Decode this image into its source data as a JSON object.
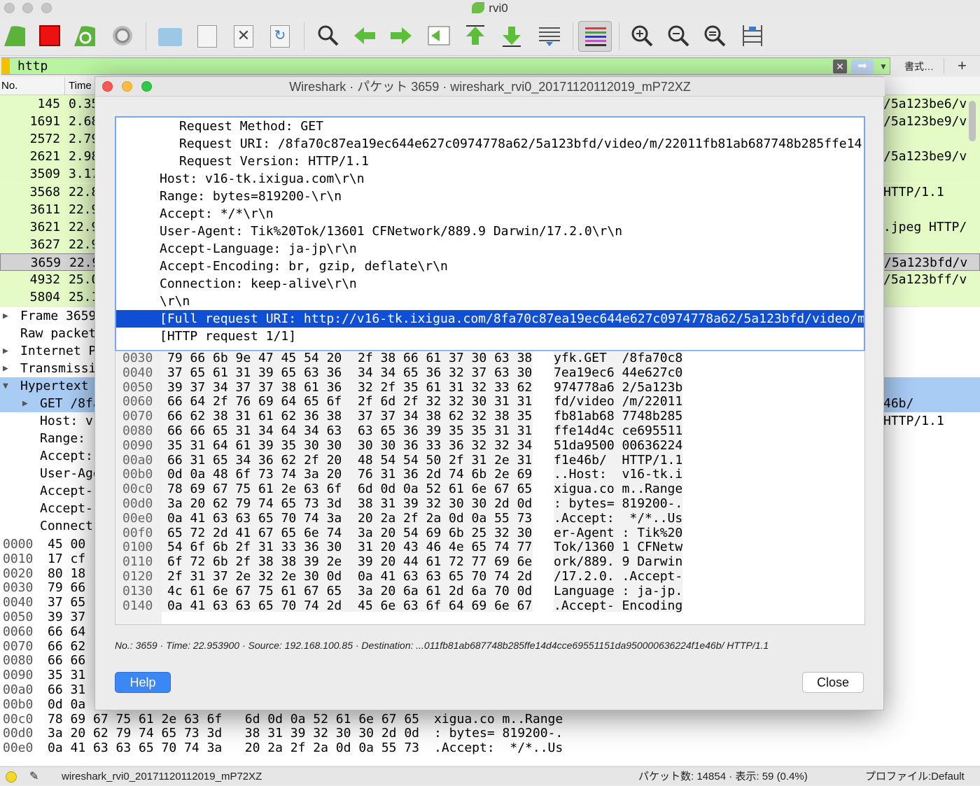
{
  "window": {
    "title": "rvi0"
  },
  "filter": {
    "value": "http",
    "format_label": "書式…"
  },
  "columns": {
    "no": "No.",
    "time": "Time"
  },
  "packets": [
    {
      "no": "145",
      "time": "0.35",
      "info": "/5a123be6/v"
    },
    {
      "no": "1691",
      "time": "2.68",
      "info": "/5a123be9/v"
    },
    {
      "no": "2572",
      "time": "2.79",
      "info": ""
    },
    {
      "no": "2621",
      "time": "2.98",
      "info": "/5a123be9/v"
    },
    {
      "no": "3509",
      "time": "3.17",
      "info": ""
    },
    {
      "no": "3568",
      "time": "22.8",
      "info": "HTTP/1.1"
    },
    {
      "no": "3611",
      "time": "22.9",
      "info": ""
    },
    {
      "no": "3621",
      "time": "22.9",
      "info": ".jpeg HTTP/"
    },
    {
      "no": "3627",
      "time": "22.9",
      "info": ""
    },
    {
      "no": "3659",
      "time": "22.9",
      "info": "/5a123bfd/v"
    },
    {
      "no": "4932",
      "time": "25.0",
      "info": "/5a123bff/v"
    },
    {
      "no": "5804",
      "time": "25.1",
      "info": ""
    }
  ],
  "details": [
    {
      "text": "Frame 3659",
      "arrow": "▶"
    },
    {
      "text": "Raw packet",
      "arrow": ""
    },
    {
      "text": "Internet P",
      "arrow": "▶"
    },
    {
      "text": "Transmissi",
      "arrow": "▶"
    },
    {
      "text": "Hypertext",
      "arrow": "▼"
    },
    {
      "text": "GET /8fa",
      "arrow": "▶"
    },
    {
      "text": "Host: v",
      "arrow": ""
    },
    {
      "text": "Range: ",
      "arrow": ""
    },
    {
      "text": "Accept:",
      "arrow": ""
    },
    {
      "text": "User-Age",
      "arrow": ""
    },
    {
      "text": "Accept-",
      "arrow": ""
    },
    {
      "text": "Accept-",
      "arrow": ""
    },
    {
      "text": "Connect",
      "arrow": ""
    }
  ],
  "details_right": "46b/ HTTP/1.1",
  "hex_bg": [
    {
      "off": "0000",
      "b": "45 00",
      "a": ""
    },
    {
      "off": "0010",
      "b": "17 cf",
      "a": ""
    },
    {
      "off": "0020",
      "b": "80 18",
      "a": ""
    },
    {
      "off": "0030",
      "b": "79 66",
      "a": ""
    },
    {
      "off": "0040",
      "b": "37 65",
      "a": ""
    },
    {
      "off": "0050",
      "b": "39 37",
      "a": ""
    },
    {
      "off": "0060",
      "b": "66 64",
      "a": ""
    },
    {
      "off": "0070",
      "b": "66 62",
      "a": ""
    },
    {
      "off": "0080",
      "b": "66 66",
      "a": ""
    },
    {
      "off": "0090",
      "b": "35 31",
      "a": ""
    },
    {
      "off": "00a0",
      "b": "66 31",
      "a": ""
    },
    {
      "off": "00b0",
      "b": "0d 0a",
      "a": ""
    },
    {
      "off": "00c0",
      "b": "78 69 67 75 61 2e 63 6f   6d 0d 0a 52 61 6e 67 65",
      "a": "xigua.co m..Range"
    },
    {
      "off": "00d0",
      "b": "3a 20 62 79 74 65 73 3d   38 31 39 32 30 30 2d 0d",
      "a": ": bytes= 819200-."
    },
    {
      "off": "00e0",
      "b": "0a 41 63 63 65 70 74 3a   20 2a 2f 2a 0d 0a 55 73",
      "a": ".Accept:  */*..Us"
    }
  ],
  "status": {
    "file": "wireshark_rvi0_20171120112019_mP72XZ",
    "packets": "パケット数: 14854 · 表示: 59 (0.4%)",
    "profile": "プロファイル:Default"
  },
  "dialog": {
    "title": "Wireshark · パケット 3659 · wireshark_rvi0_20171120112019_mP72XZ",
    "tree": [
      {
        "text": "Request Method: GET",
        "indent": 2
      },
      {
        "text": "Request URI: /8fa70c87ea19ec644e627c0974778a62/5a123bfd/video/m/22011fb81ab687748b285ffe14",
        "indent": 2
      },
      {
        "text": "Request Version: HTTP/1.1",
        "indent": 2
      },
      {
        "text": "Host: v16-tk.ixigua.com\\r\\n",
        "indent": 1
      },
      {
        "text": "Range: bytes=819200-\\r\\n",
        "indent": 1
      },
      {
        "text": "Accept: */*\\r\\n",
        "indent": 1
      },
      {
        "text": "User-Agent: Tik%20Tok/13601 CFNetwork/889.9 Darwin/17.2.0\\r\\n",
        "indent": 1
      },
      {
        "text": "Accept-Language: ja-jp\\r\\n",
        "indent": 1
      },
      {
        "text": "Accept-Encoding: br, gzip, deflate\\r\\n",
        "indent": 1
      },
      {
        "text": "Connection: keep-alive\\r\\n",
        "indent": 1
      },
      {
        "text": "\\r\\n",
        "indent": 1
      },
      {
        "text": "[Full request URI: http://v16-tk.ixigua.com/8fa70c87ea19ec644e627c0974778a62/5a123bfd/video/m",
        "indent": 1,
        "selected": true
      },
      {
        "text": "[HTTP request 1/1]",
        "indent": 1
      }
    ],
    "hex": [
      {
        "off": "0030",
        "b1": "79 66 6b 9e 47 45 54 20",
        "b2": "2f 38 66 61 37 30 63 38",
        "a": "yfk.GET  /8fa70c8"
      },
      {
        "off": "0040",
        "b1": "37 65 61 31 39 65 63 36",
        "b2": "34 34 65 36 32 37 63 30",
        "a": "7ea19ec6 44e627c0"
      },
      {
        "off": "0050",
        "b1": "39 37 34 37 37 38 61 36",
        "b2": "32 2f 35 61 31 32 33 62",
        "a": "974778a6 2/5a123b"
      },
      {
        "off": "0060",
        "b1": "66 64 2f 76 69 64 65 6f",
        "b2": "2f 6d 2f 32 32 30 31 31",
        "a": "fd/video /m/22011"
      },
      {
        "off": "0070",
        "b1": "66 62 38 31 61 62 36 38",
        "b2": "37 37 34 38 62 32 38 35",
        "a": "fb81ab68 7748b285"
      },
      {
        "off": "0080",
        "b1": "66 66 65 31 34 64 34 63",
        "b2": "63 65 36 39 35 35 31 31",
        "a": "ffe14d4c ce695511"
      },
      {
        "off": "0090",
        "b1": "35 31 64 61 39 35 30 30",
        "b2": "30 30 36 33 36 32 32 34",
        "a": "51da9500 00636224"
      },
      {
        "off": "00a0",
        "b1": "66 31 65 34 36 62 2f 20",
        "b2": "48 54 54 50 2f 31 2e 31",
        "a": "f1e46b/  HTTP/1.1"
      },
      {
        "off": "00b0",
        "b1": "0d 0a 48 6f 73 74 3a 20",
        "b2": "76 31 36 2d 74 6b 2e 69",
        "a": "..Host:  v16-tk.i"
      },
      {
        "off": "00c0",
        "b1": "78 69 67 75 61 2e 63 6f",
        "b2": "6d 0d 0a 52 61 6e 67 65",
        "a": "xigua.co m..Range"
      },
      {
        "off": "00d0",
        "b1": "3a 20 62 79 74 65 73 3d",
        "b2": "38 31 39 32 30 30 2d 0d",
        "a": ": bytes= 819200-."
      },
      {
        "off": "00e0",
        "b1": "0a 41 63 63 65 70 74 3a",
        "b2": "20 2a 2f 2a 0d 0a 55 73",
        "a": ".Accept:  */*..Us"
      },
      {
        "off": "00f0",
        "b1": "65 72 2d 41 67 65 6e 74",
        "b2": "3a 20 54 69 6b 25 32 30",
        "a": "er-Agent : Tik%20"
      },
      {
        "off": "0100",
        "b1": "54 6f 6b 2f 31 33 36 30",
        "b2": "31 20 43 46 4e 65 74 77",
        "a": "Tok/1360 1 CFNetw"
      },
      {
        "off": "0110",
        "b1": "6f 72 6b 2f 38 38 39 2e",
        "b2": "39 20 44 61 72 77 69 6e",
        "a": "ork/889. 9 Darwin"
      },
      {
        "off": "0120",
        "b1": "2f 31 37 2e 32 2e 30 0d",
        "b2": "0a 41 63 63 65 70 74 2d",
        "a": "/17.2.0. .Accept-"
      },
      {
        "off": "0130",
        "b1": "4c 61 6e 67 75 61 67 65",
        "b2": "3a 20 6a 61 2d 6a 70 0d",
        "a": "Language : ja-jp."
      },
      {
        "off": "0140",
        "b1": "0a 41 63 63 65 70 74 2d",
        "b2": "45 6e 63 6f 64 69 6e 67",
        "a": ".Accept- Encoding"
      }
    ],
    "info": "No.: 3659 · Time: 22.953900 · Source: 192.168.100.85 · Destination: ...011fb81ab687748b285ffe14d4cce69551151da950000636224f1e46b/ HTTP/1.1",
    "help_label": "Help",
    "close_label": "Close"
  }
}
